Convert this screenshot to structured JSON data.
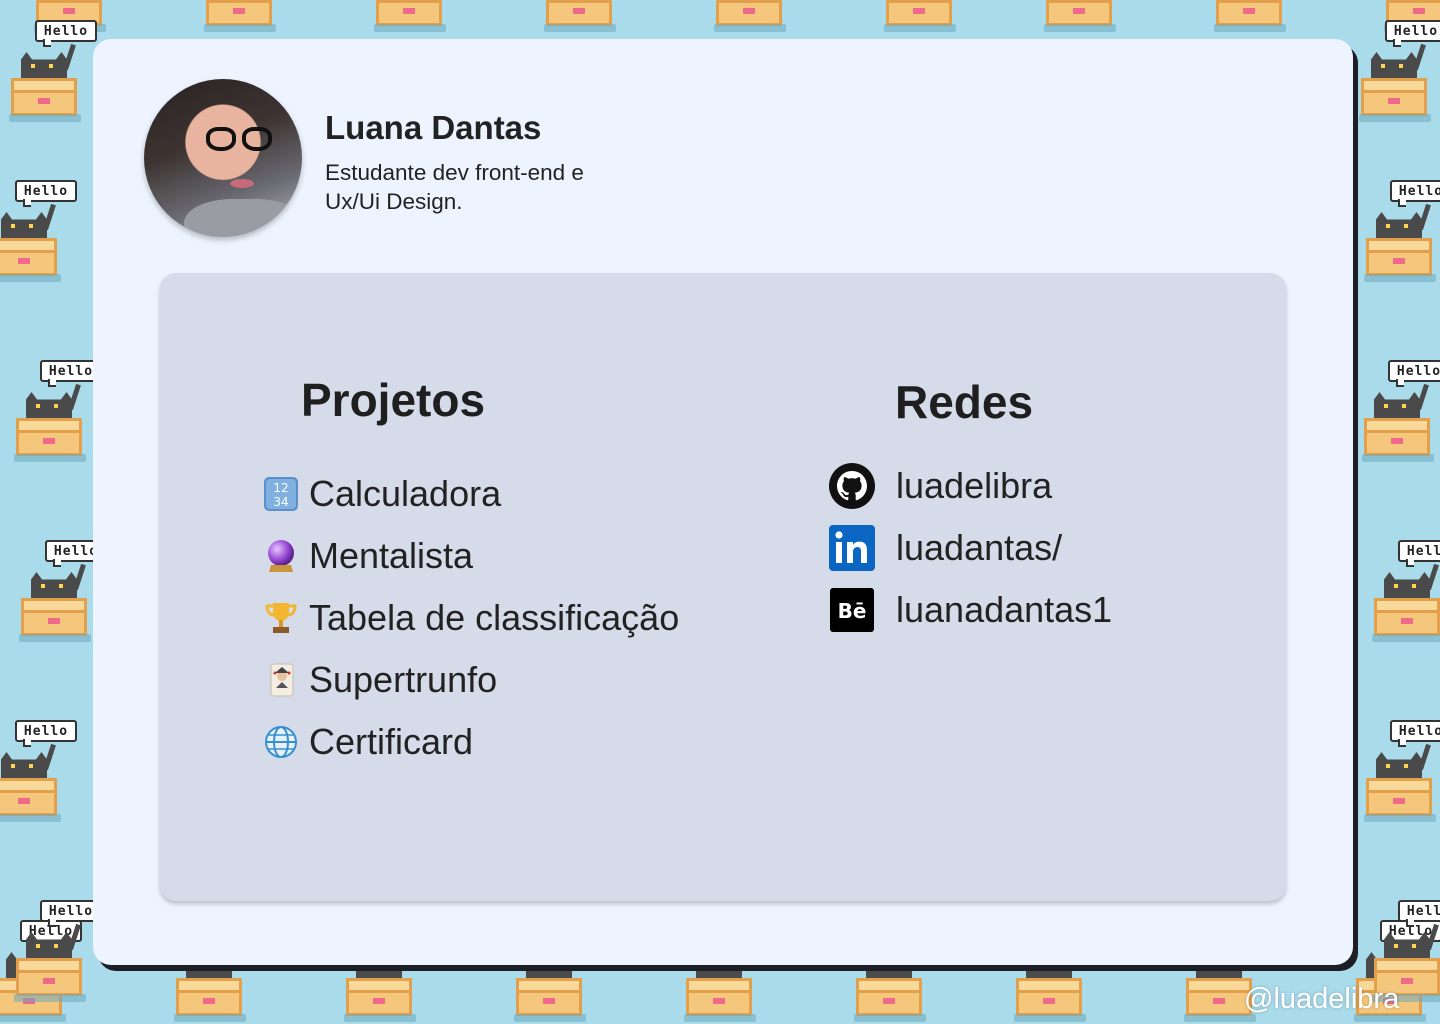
{
  "profile": {
    "name": "Luana Dantas",
    "bio": "Estudante dev front-end  e\nUx/Ui Design."
  },
  "projects": {
    "title": "Projetos",
    "items": [
      {
        "label": "Calculadora",
        "icon": "input-numbers-icon"
      },
      {
        "label": "Mentalista",
        "icon": "crystal-ball-icon"
      },
      {
        "label": "Tabela de classificação",
        "icon": "trophy-icon"
      },
      {
        "label": "Supertrunfo",
        "icon": "joker-card-icon"
      },
      {
        "label": "Certificard",
        "icon": "globe-icon"
      }
    ]
  },
  "networks": {
    "title": "Redes",
    "items": [
      {
        "label": "luadelibra",
        "icon": "github-icon"
      },
      {
        "label": "luadantas/",
        "icon": "linkedin-icon"
      },
      {
        "label": "luanadantas1",
        "icon": "behance-icon"
      }
    ]
  },
  "background": {
    "bubble_text": "Hello"
  },
  "watermark": "@luadelibra",
  "colors": {
    "background": "#a9dbea",
    "card": "#edf4ff",
    "panel": "#d5dbe8",
    "linkedin": "#0a66c2",
    "behance": "#000000"
  }
}
